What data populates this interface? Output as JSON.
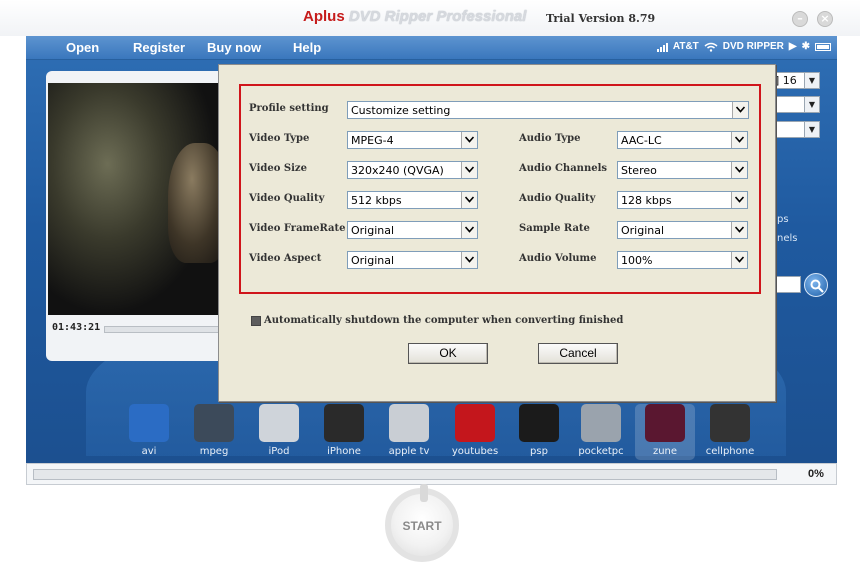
{
  "window": {
    "title_brand": "Aplus",
    "title_product": " DVD Ripper Professional",
    "version": "Trial Version 8.79"
  },
  "menu": [
    "Open",
    "Register",
    "Buy now",
    "Help"
  ],
  "status_bar": {
    "carrier": "AT&T",
    "app_label": "DVD RIPPER"
  },
  "player": {
    "time": "01:43:21"
  },
  "right_panel": {
    "fragment_1": "] 16",
    "fragment_2": "ps",
    "fragment_3": "nels"
  },
  "dialog": {
    "profile_label": "Profile setting",
    "profile_value": "Customize setting",
    "video_type_label": "Video Type",
    "video_type_value": "MPEG-4",
    "video_size_label": "Video Size",
    "video_size_value": "320x240 (QVGA)",
    "video_quality_label": "Video Quality",
    "video_quality_value": "512 kbps",
    "video_framerate_label": "Video FrameRate",
    "video_framerate_value": "Original",
    "video_aspect_label": "Video Aspect",
    "video_aspect_value": "Original",
    "audio_type_label": "Audio Type",
    "audio_type_value": "AAC-LC",
    "audio_channels_label": "Audio Channels",
    "audio_channels_value": "Stereo",
    "audio_quality_label": "Audio Quality",
    "audio_quality_value": "128 kbps",
    "sample_rate_label": "Sample Rate",
    "sample_rate_value": "Original",
    "audio_volume_label": "Audio Volume",
    "audio_volume_value": "100%",
    "shutdown_label": "Automatically shutdown the computer when converting finished",
    "ok_label": "OK",
    "cancel_label": "Cancel"
  },
  "devices": [
    {
      "label": "avi",
      "icon": "avi-icon",
      "color": "#2b6cc4"
    },
    {
      "label": "mpeg",
      "icon": "film-icon",
      "color": "#3c4a5a"
    },
    {
      "label": "iPod",
      "icon": "ipod-icon",
      "color": "#cfd4da"
    },
    {
      "label": "iPhone",
      "icon": "iphone-icon",
      "color": "#2a2a2a"
    },
    {
      "label": "apple tv",
      "icon": "apple-tv-icon",
      "color": "#c9ced4"
    },
    {
      "label": "youtubes",
      "icon": "youtube-icon",
      "color": "#c4161c"
    },
    {
      "label": "psp",
      "icon": "psp-icon",
      "color": "#1b1b1b"
    },
    {
      "label": "pocketpc",
      "icon": "pocketpc-icon",
      "color": "#9aa3ad"
    },
    {
      "label": "zune",
      "icon": "zune-icon",
      "color": "#5a1730"
    },
    {
      "label": "cellphone",
      "icon": "cellphone-icon",
      "color": "#333333"
    }
  ],
  "progress": {
    "value": 0,
    "label": "0%"
  },
  "start_label": "START"
}
